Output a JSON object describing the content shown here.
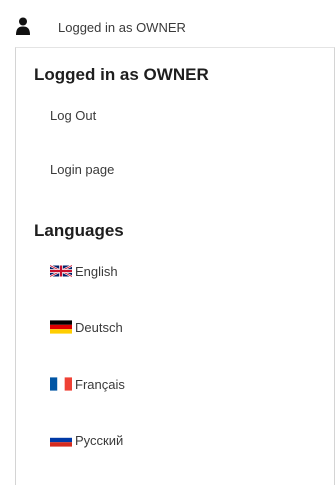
{
  "topbar": {
    "user_icon": "person-icon",
    "label": "Logged in as OWNER"
  },
  "account_section": {
    "title": "Logged in as OWNER",
    "items": [
      {
        "label": "Log Out"
      },
      {
        "label": "Login page"
      }
    ]
  },
  "languages_section": {
    "title": "Languages",
    "items": [
      {
        "label": "English",
        "icon": "uk-flag-icon"
      },
      {
        "label": "Deutsch",
        "icon": "germany-flag-icon"
      },
      {
        "label": "Français",
        "icon": "france-flag-icon"
      },
      {
        "label": "Русский",
        "icon": "russia-flag-icon"
      }
    ]
  }
}
